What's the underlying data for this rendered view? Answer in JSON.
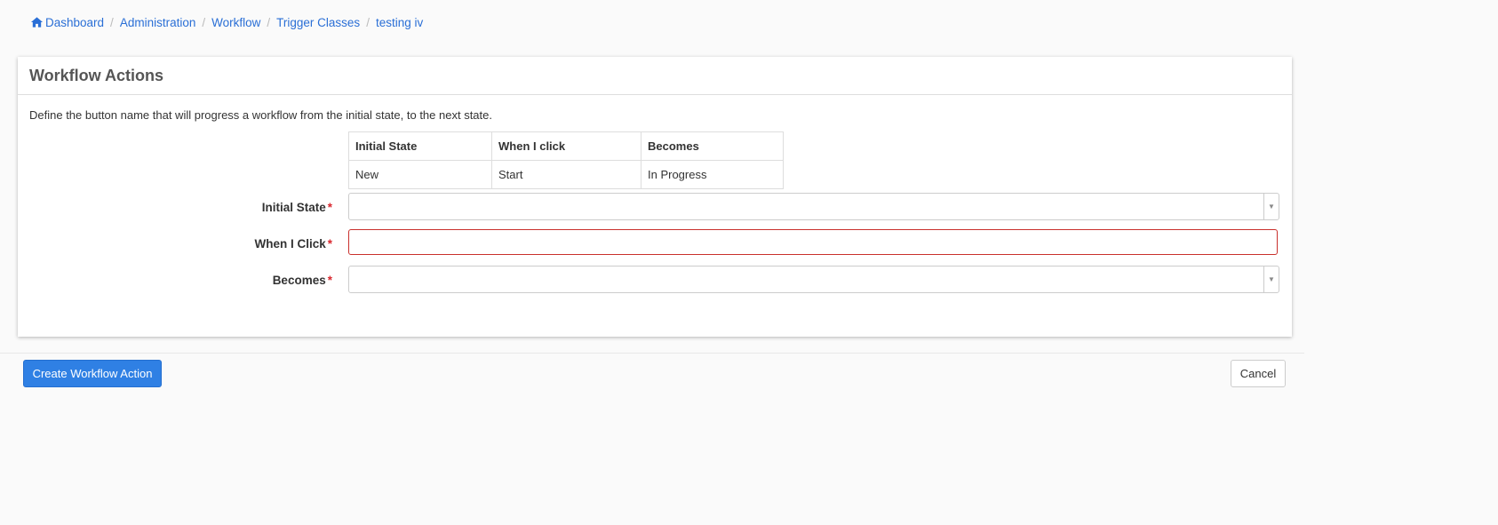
{
  "breadcrumb": {
    "items": [
      "Dashboard",
      "Administration",
      "Workflow",
      "Trigger Classes",
      "testing iv"
    ],
    "separator": "/"
  },
  "panel": {
    "title": "Workflow Actions",
    "description": "Define the button name that will progress a workflow from the initial state, to the next state."
  },
  "example_table": {
    "headers": [
      "Initial State",
      "When I click",
      "Becomes"
    ],
    "rows": [
      [
        "New",
        "Start",
        "In Progress"
      ]
    ]
  },
  "form": {
    "initial_state": {
      "label": "Initial State",
      "required_mark": "*",
      "value": ""
    },
    "when_i_click": {
      "label": "When I Click",
      "required_mark": "*",
      "value": "",
      "placeholder": ""
    },
    "becomes": {
      "label": "Becomes",
      "required_mark": "*",
      "value": ""
    }
  },
  "buttons": {
    "create": "Create Workflow Action",
    "cancel": "Cancel"
  },
  "colors": {
    "link": "#2a6fd6",
    "primary": "#2f80e4",
    "required": "#d9272e",
    "error_border": "#c9302c"
  },
  "icons": {
    "home": "home-icon",
    "dropdown": "caret-down-icon"
  }
}
